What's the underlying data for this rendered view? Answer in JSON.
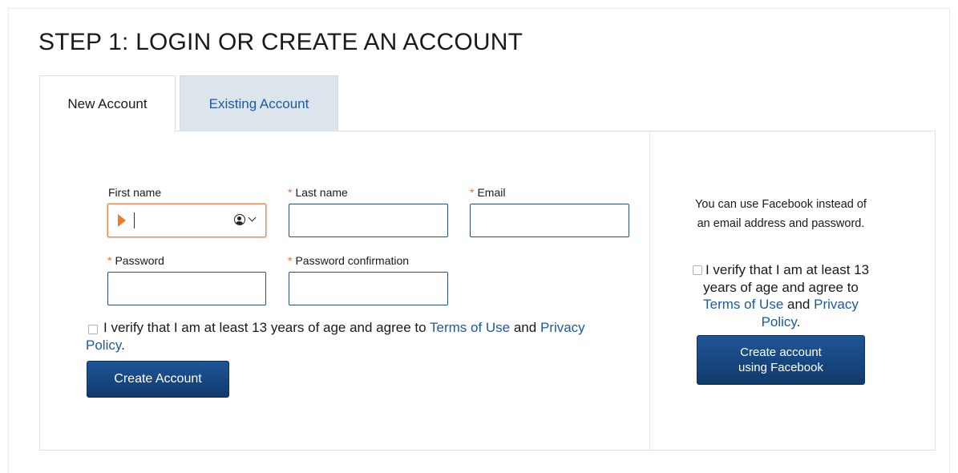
{
  "page": {
    "title": "STEP 1: LOGIN OR CREATE AN ACCOUNT"
  },
  "tabs": [
    {
      "label": "New Account",
      "active": true
    },
    {
      "label": "Existing Account",
      "active": false
    }
  ],
  "form": {
    "required_marker": "*",
    "first_name": {
      "label": "First name",
      "value": "",
      "required": false
    },
    "last_name": {
      "label": "Last name",
      "value": "",
      "required": true
    },
    "email": {
      "label": "Email",
      "value": "",
      "required": true
    },
    "password": {
      "label": "Password",
      "value": "",
      "required": true
    },
    "password_confirmation": {
      "label": "Password confirmation",
      "value": "",
      "required": true
    },
    "terms": {
      "text_before": "I verify that I am at least 13 years of age and agree to ",
      "terms_link": "Terms of Use",
      "text_and": " and ",
      "privacy_link": "Privacy Policy",
      "text_after": ".",
      "checked": false
    },
    "submit_label": "Create Account"
  },
  "facebook": {
    "info": "You can use Facebook instead of an email address and password.",
    "terms": {
      "text_before": "I verify that I am at least 13 years of age and agree to ",
      "terms_link": "Terms of Use",
      "text_and": " and ",
      "privacy_link": "Privacy Policy",
      "text_after": ".",
      "checked": false
    },
    "button_line1": "Create account",
    "button_line2": "using Facebook"
  },
  "icons": {
    "autofill": "play-icon",
    "contact_card": "contact-card-icon",
    "dropdown": "chevron-down-icon"
  },
  "colors": {
    "link": "#1d5aa2",
    "required": "#e8702a",
    "button": "#174a85",
    "focus_border": "#ef8a58"
  }
}
